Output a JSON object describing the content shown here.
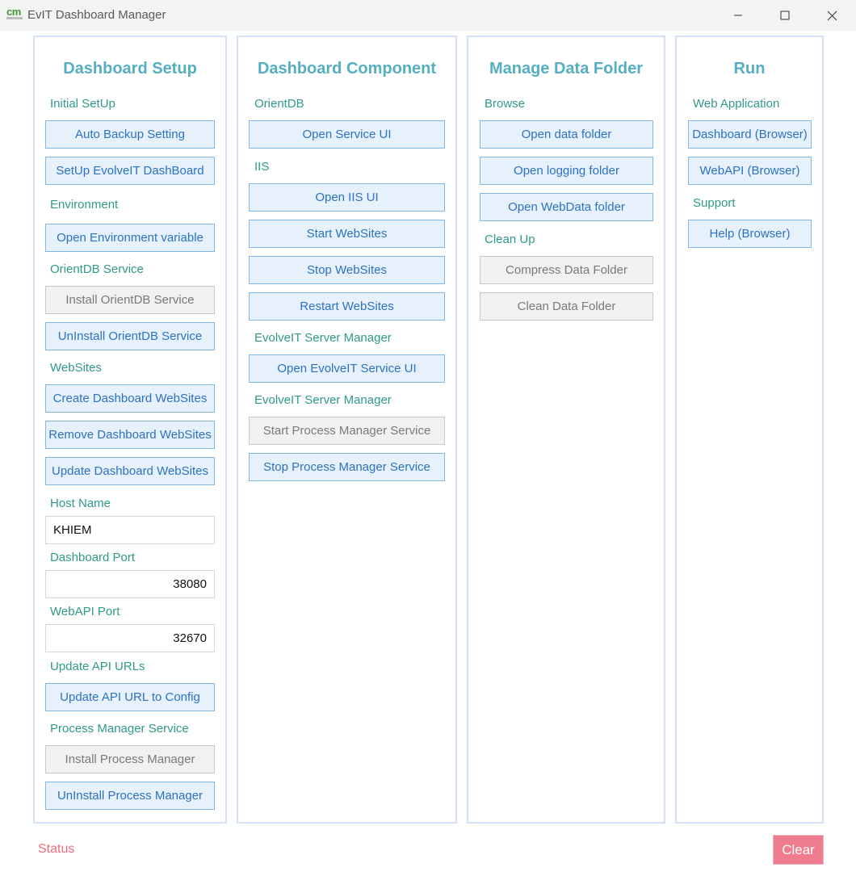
{
  "window": {
    "title": "EvIT Dashboard Manager",
    "logo_text": "cm"
  },
  "setup": {
    "title": "Dashboard Setup",
    "initial_setup_label": "Initial SetUp",
    "auto_backup": "Auto Backup Setting",
    "setup_dashboard": "SetUp EvolveIT DashBoard",
    "environment_label": "Environment",
    "open_env": "Open Environment variable",
    "orientdb_service_label": "OrientDB Service",
    "install_orientdb": "Install OrientDB Service",
    "uninstall_orientdb": "UnInstall OrientDB Service",
    "websites_label": "WebSites",
    "create_websites": "Create Dashboard WebSites",
    "remove_websites": "Remove Dashboard WebSites",
    "update_websites": "Update Dashboard WebSites",
    "host_name_label": "Host Name",
    "host_name_value": "KHIEM",
    "dashboard_port_label": "Dashboard Port",
    "dashboard_port_value": "38080",
    "webapi_port_label": "WebAPI Port",
    "webapi_port_value": "32670",
    "update_api_urls_label": "Update API URLs",
    "update_api_url": "Update API URL to Config",
    "process_manager_label": "Process Manager Service",
    "install_process_manager": "Install Process Manager",
    "uninstall_process_manager": "UnInstall Process Manager"
  },
  "component": {
    "title": "Dashboard Component",
    "orientdb_label": "OrientDB",
    "open_service_ui": "Open Service UI",
    "iis_label": "IIS",
    "open_iis_ui": "Open IIS UI",
    "start_websites": "Start WebSites",
    "stop_websites": "Stop WebSites",
    "restart_websites": "Restart WebSites",
    "server_manager_label_1": "EvolveIT Server Manager",
    "open_evolveit_service_ui": "Open EvolveIT Service UI",
    "server_manager_label_2": "EvolveIT Server Manager",
    "start_process_manager": "Start Process Manager Service",
    "stop_process_manager": "Stop Process Manager Service"
  },
  "data_folder": {
    "title": "Manage Data Folder",
    "browse_label": "Browse",
    "open_data_folder": "Open data folder",
    "open_logging_folder": "Open logging folder",
    "open_webdata_folder": "Open WebData folder",
    "cleanup_label": "Clean Up",
    "compress_data_folder": "Compress Data Folder",
    "clean_data_folder": "Clean Data Folder"
  },
  "run": {
    "title": "Run",
    "web_application_label": "Web Application",
    "dashboard_browser": "Dashboard (Browser)",
    "webapi_browser": "WebAPI (Browser)",
    "support_label": "Support",
    "help_browser": "Help (Browser)"
  },
  "footer": {
    "status": "Status",
    "clear": "Clear"
  },
  "colors": {
    "accent_title": "#56aec3",
    "section_label": "#2f9a88",
    "button_text": "#2b72c2",
    "button_bg": "#e7f1fb",
    "disabled_text": "#7a7a7a",
    "status": "#ea6b80",
    "clear_bg": "#ee7b8e"
  }
}
